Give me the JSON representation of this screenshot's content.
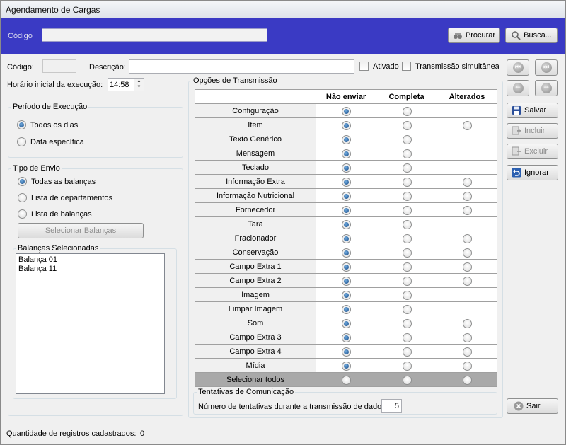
{
  "window": {
    "title": "Agendamento de Cargas"
  },
  "search": {
    "label": "Código",
    "value": "",
    "procurar_label": "Procurar",
    "busca_label": "Busca..."
  },
  "form": {
    "codigo_label": "Código:",
    "codigo_value": "",
    "descricao_label": "Descrição:",
    "descricao_value": "",
    "ativado_label": "Ativado",
    "transmissao_label": "Transmissão simultânea",
    "horario_label": "Horário inicial da execução:",
    "horario_value": "14:58"
  },
  "periodo": {
    "title": "Período de Execução",
    "options": [
      "Todos os dias",
      "Data específica"
    ],
    "selected": 0
  },
  "tipo_envio": {
    "title": "Tipo de Envio",
    "options": [
      "Todas as balanças",
      "Lista de departamentos",
      "Lista de balanças"
    ],
    "selected": 0,
    "selecionar_label": "Selecionar Balanças"
  },
  "balancas": {
    "title": "Balanças Selecionadas",
    "items": [
      "Balança 01",
      "Balança 11"
    ]
  },
  "opcoes": {
    "title": "Opções de Transmissão",
    "columns": [
      "Não enviar",
      "Completa",
      "Alterados"
    ],
    "rows": [
      {
        "name": "Configuração",
        "radios": [
          true,
          false,
          null
        ]
      },
      {
        "name": "Item",
        "radios": [
          true,
          false,
          false
        ]
      },
      {
        "name": "Texto Genérico",
        "radios": [
          true,
          false,
          null
        ]
      },
      {
        "name": "Mensagem",
        "radios": [
          true,
          false,
          null
        ]
      },
      {
        "name": "Teclado",
        "radios": [
          true,
          false,
          null
        ]
      },
      {
        "name": "Informação Extra",
        "radios": [
          true,
          false,
          false
        ]
      },
      {
        "name": "Informação Nutricional",
        "radios": [
          true,
          false,
          false
        ]
      },
      {
        "name": "Fornecedor",
        "radios": [
          true,
          false,
          false
        ]
      },
      {
        "name": "Tara",
        "radios": [
          true,
          false,
          null
        ]
      },
      {
        "name": "Fracionador",
        "radios": [
          true,
          false,
          false
        ]
      },
      {
        "name": "Conservação",
        "radios": [
          true,
          false,
          false
        ]
      },
      {
        "name": "Campo Extra 1",
        "radios": [
          true,
          false,
          false
        ]
      },
      {
        "name": "Campo Extra 2",
        "radios": [
          true,
          false,
          false
        ]
      },
      {
        "name": "Imagem",
        "radios": [
          true,
          false,
          null
        ]
      },
      {
        "name": "Limpar Imagem",
        "radios": [
          true,
          false,
          null
        ]
      },
      {
        "name": "Som",
        "radios": [
          true,
          false,
          false
        ]
      },
      {
        "name": "Campo Extra 3",
        "radios": [
          true,
          false,
          false
        ]
      },
      {
        "name": "Campo Extra 4",
        "radios": [
          true,
          false,
          false
        ]
      },
      {
        "name": "Mídia",
        "radios": [
          true,
          false,
          false
        ]
      }
    ],
    "select_all_label": "Selecionar todos"
  },
  "tentativas": {
    "title": "Tentativas de Comunicação",
    "label": "Número de tentativas durante a transmissão de dados",
    "value": "5"
  },
  "actions": {
    "salvar": "Salvar",
    "incluir": "Incluir",
    "excluir": "Excluir",
    "ignorar": "Ignorar",
    "sair": "Sair"
  },
  "status": {
    "label": "Quantidade de registros cadastrados:",
    "count": "0"
  },
  "colors": {
    "search_bar": "#3a3ac4",
    "radio_selected": "#1b4f8a",
    "select_all_row": "#a9a9a9"
  }
}
